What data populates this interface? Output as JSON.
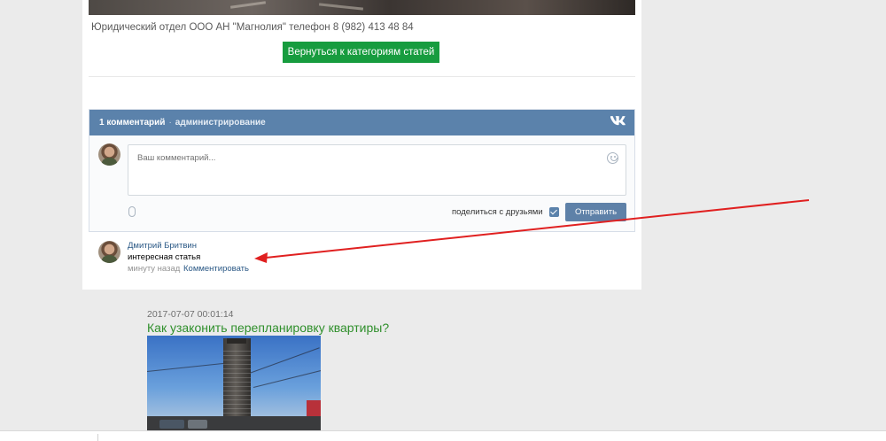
{
  "article": {
    "legal_note": "Юридический отдел ООО АН \"Магнолия\" телефон 8 (982) 413 48 84",
    "back_button_label": "Вернуться к категориям статей"
  },
  "vk_comments": {
    "count_label": "1 комментарий",
    "separator": "·",
    "admin_label": "администрирование",
    "logo": "vk",
    "input_placeholder": "Ваш комментарий...",
    "share_label": "поделиться с друзьями",
    "share_checked": true,
    "send_label": "Отправить",
    "comments": [
      {
        "author": "Дмитрий Бритвин",
        "text": "интересная статья",
        "time": "минуту назад",
        "reply_label": "Комментировать"
      }
    ]
  },
  "next_post": {
    "date": "2017-07-07 00:01:14",
    "title": "Как узаконить перепланировку квартиры?"
  },
  "colors": {
    "accent_green": "#179c3f",
    "vk_blue": "#5b82ab",
    "annotation_red": "#e02020"
  }
}
